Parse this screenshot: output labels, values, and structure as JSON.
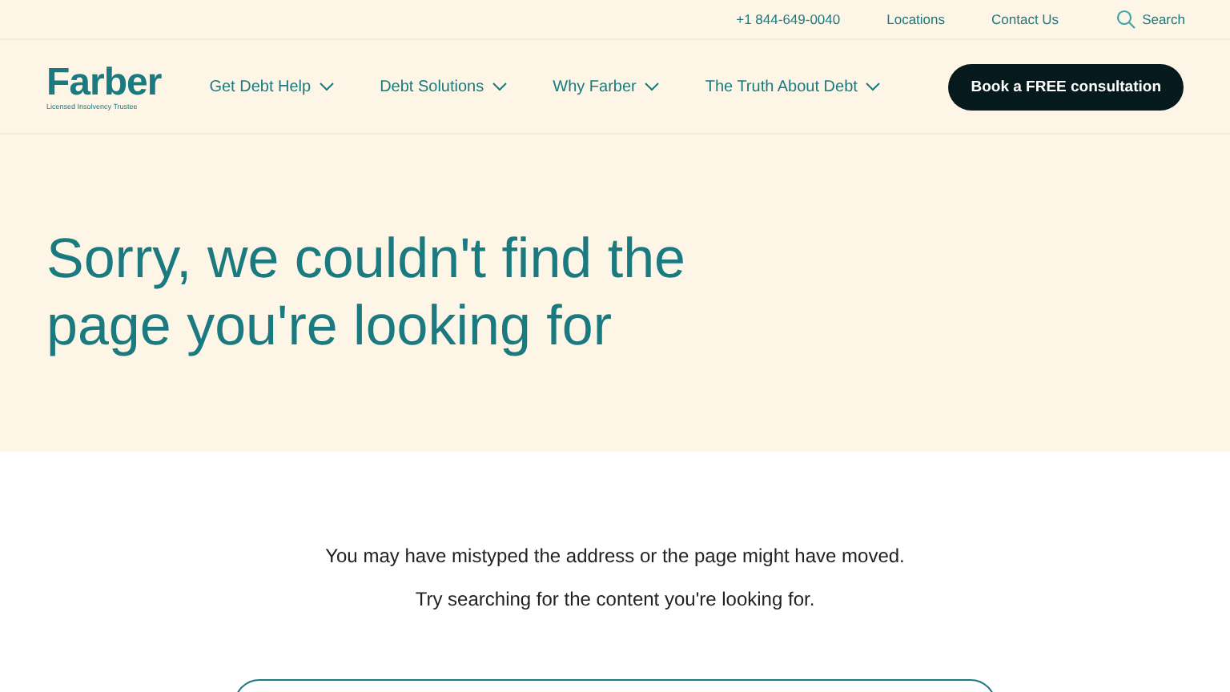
{
  "utility_bar": {
    "phone": "+1 844-649-0040",
    "links": [
      "Locations",
      "Contact Us"
    ],
    "search_label": "Search"
  },
  "header": {
    "logo": {
      "name": "Farber",
      "tagline": "Licensed Insolvency Trustee"
    },
    "nav": [
      {
        "label": "Get Debt Help",
        "has_menu": true
      },
      {
        "label": "Debt Solutions",
        "has_menu": true
      },
      {
        "label": "Why Farber",
        "has_menu": true
      },
      {
        "label": "The Truth About Debt",
        "has_menu": true
      }
    ],
    "cta": "Book a FREE consultation"
  },
  "hero": {
    "title": "Sorry, we couldn't find the page you're looking for"
  },
  "body": {
    "messages": [
      "You may have mistyped the address or the page might have moved.",
      "Try searching for the content you're looking for."
    ]
  }
}
